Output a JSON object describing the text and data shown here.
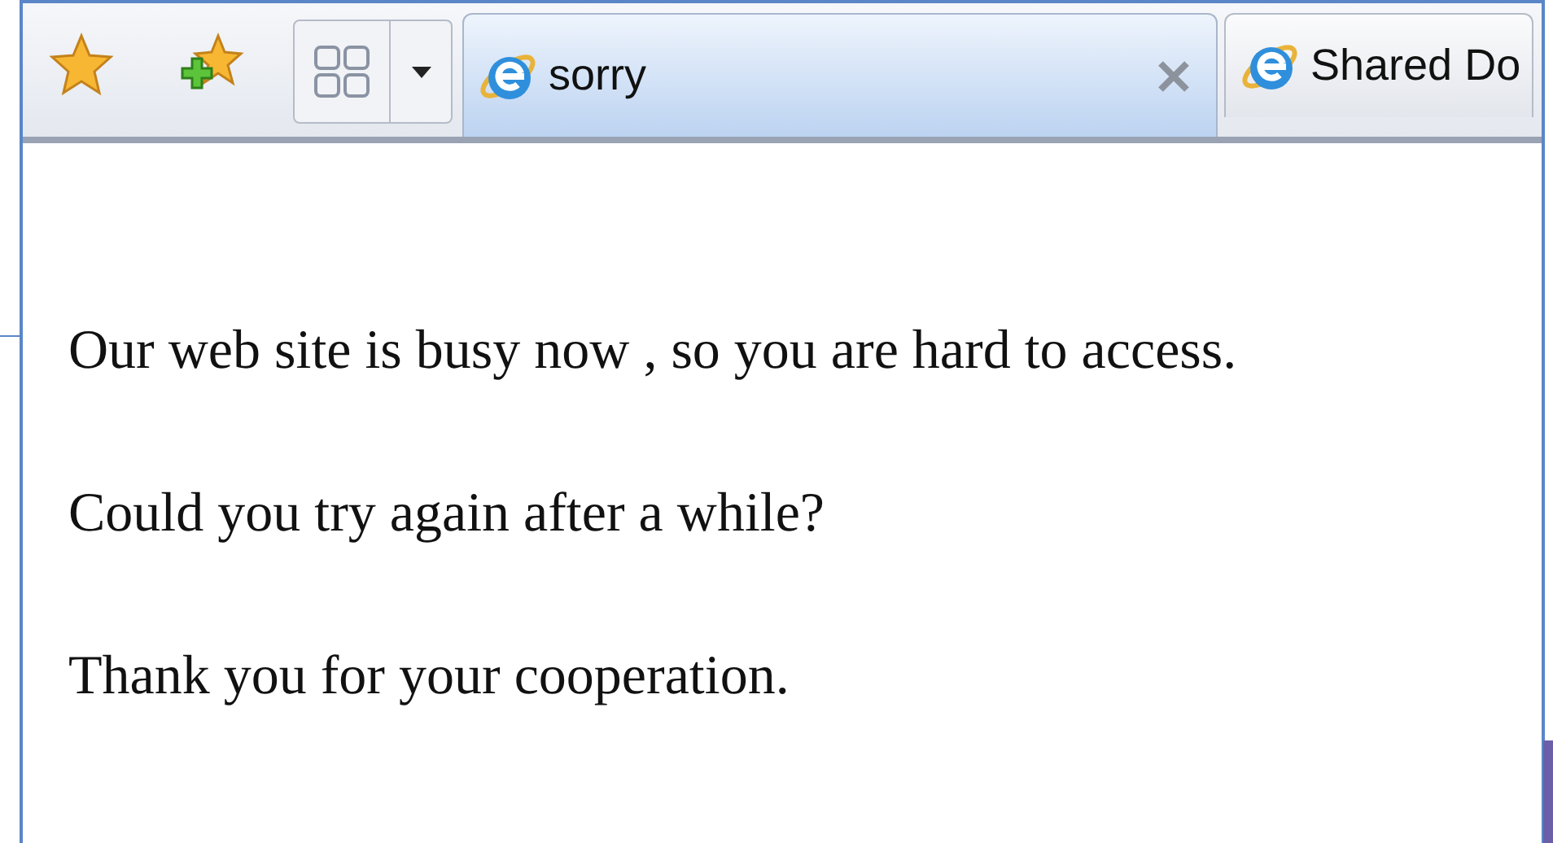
{
  "tabs": [
    {
      "label": "sorry",
      "selected": true
    },
    {
      "label": "Shared Do",
      "selected": false
    }
  ],
  "page": {
    "paragraphs": [
      "Our web site is busy now , so you are hard to access.",
      "Could you try again after a while?",
      "Thank you for your cooperation."
    ]
  }
}
